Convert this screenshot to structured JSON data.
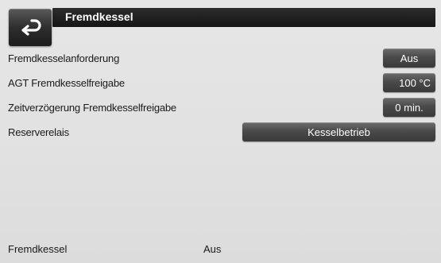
{
  "header": {
    "title": "Fremdkessel",
    "back_icon": "return-arrow-icon"
  },
  "settings": {
    "rows": [
      {
        "label": "Fremdkesselanforderung",
        "value": "Aus"
      },
      {
        "label": "AGT Fremdkesselfreigabe",
        "value": "100 °C"
      },
      {
        "label": "Zeitverzögerung Fremdkesselfreigabe",
        "value": "0 min."
      },
      {
        "label": "Reserverelais",
        "value": "Kesselbetrieb"
      }
    ]
  },
  "status": {
    "label": "Fremdkessel",
    "value": "Aus"
  },
  "colors": {
    "background": "#e1e1e1",
    "title_bar": "#1e1e1e",
    "button": "#4a4a4a",
    "button_text": "#ffffff"
  }
}
